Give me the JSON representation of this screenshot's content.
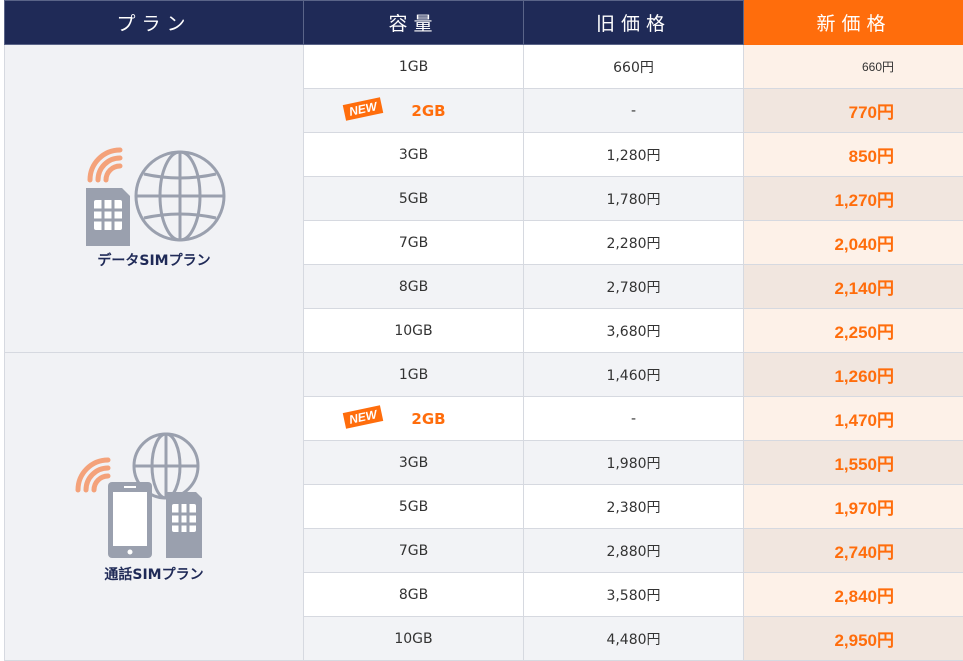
{
  "headers": {
    "plan": "プラン",
    "capacity": "容量",
    "old_price": "旧価格",
    "new_price": "新価格"
  },
  "new_badge": "NEW",
  "colors": {
    "header_navy": "#1f2a57",
    "accent_orange": "#ff6d0c",
    "icon_gray": "#9aa0ae"
  },
  "groups": [
    {
      "label": "データSIMプラン",
      "icon": "data-sim-globe-icon",
      "rows": [
        {
          "capacity": "1GB",
          "old": "660円",
          "new": "660円",
          "is_new": false,
          "highlight": false
        },
        {
          "capacity": "2GB",
          "old": "-",
          "new": "770円",
          "is_new": true,
          "highlight": true
        },
        {
          "capacity": "3GB",
          "old": "1,280円",
          "new": "850円",
          "is_new": false,
          "highlight": true
        },
        {
          "capacity": "5GB",
          "old": "1,780円",
          "new": "1,270円",
          "is_new": false,
          "highlight": true
        },
        {
          "capacity": "7GB",
          "old": "2,280円",
          "new": "2,040円",
          "is_new": false,
          "highlight": true
        },
        {
          "capacity": "8GB",
          "old": "2,780円",
          "new": "2,140円",
          "is_new": false,
          "highlight": true
        },
        {
          "capacity": "10GB",
          "old": "3,680円",
          "new": "2,250円",
          "is_new": false,
          "highlight": true
        }
      ]
    },
    {
      "label": "通話SIMプラン",
      "icon": "voice-sim-phone-icon",
      "rows": [
        {
          "capacity": "1GB",
          "old": "1,460円",
          "new": "1,260円",
          "is_new": false,
          "highlight": true
        },
        {
          "capacity": "2GB",
          "old": "-",
          "new": "1,470円",
          "is_new": true,
          "highlight": true
        },
        {
          "capacity": "3GB",
          "old": "1,980円",
          "new": "1,550円",
          "is_new": false,
          "highlight": true
        },
        {
          "capacity": "5GB",
          "old": "2,380円",
          "new": "1,970円",
          "is_new": false,
          "highlight": true
        },
        {
          "capacity": "7GB",
          "old": "2,880円",
          "new": "2,740円",
          "is_new": false,
          "highlight": true
        },
        {
          "capacity": "8GB",
          "old": "3,580円",
          "new": "2,840円",
          "is_new": false,
          "highlight": true
        },
        {
          "capacity": "10GB",
          "old": "4,480円",
          "new": "2,950円",
          "is_new": false,
          "highlight": true
        }
      ]
    }
  ]
}
